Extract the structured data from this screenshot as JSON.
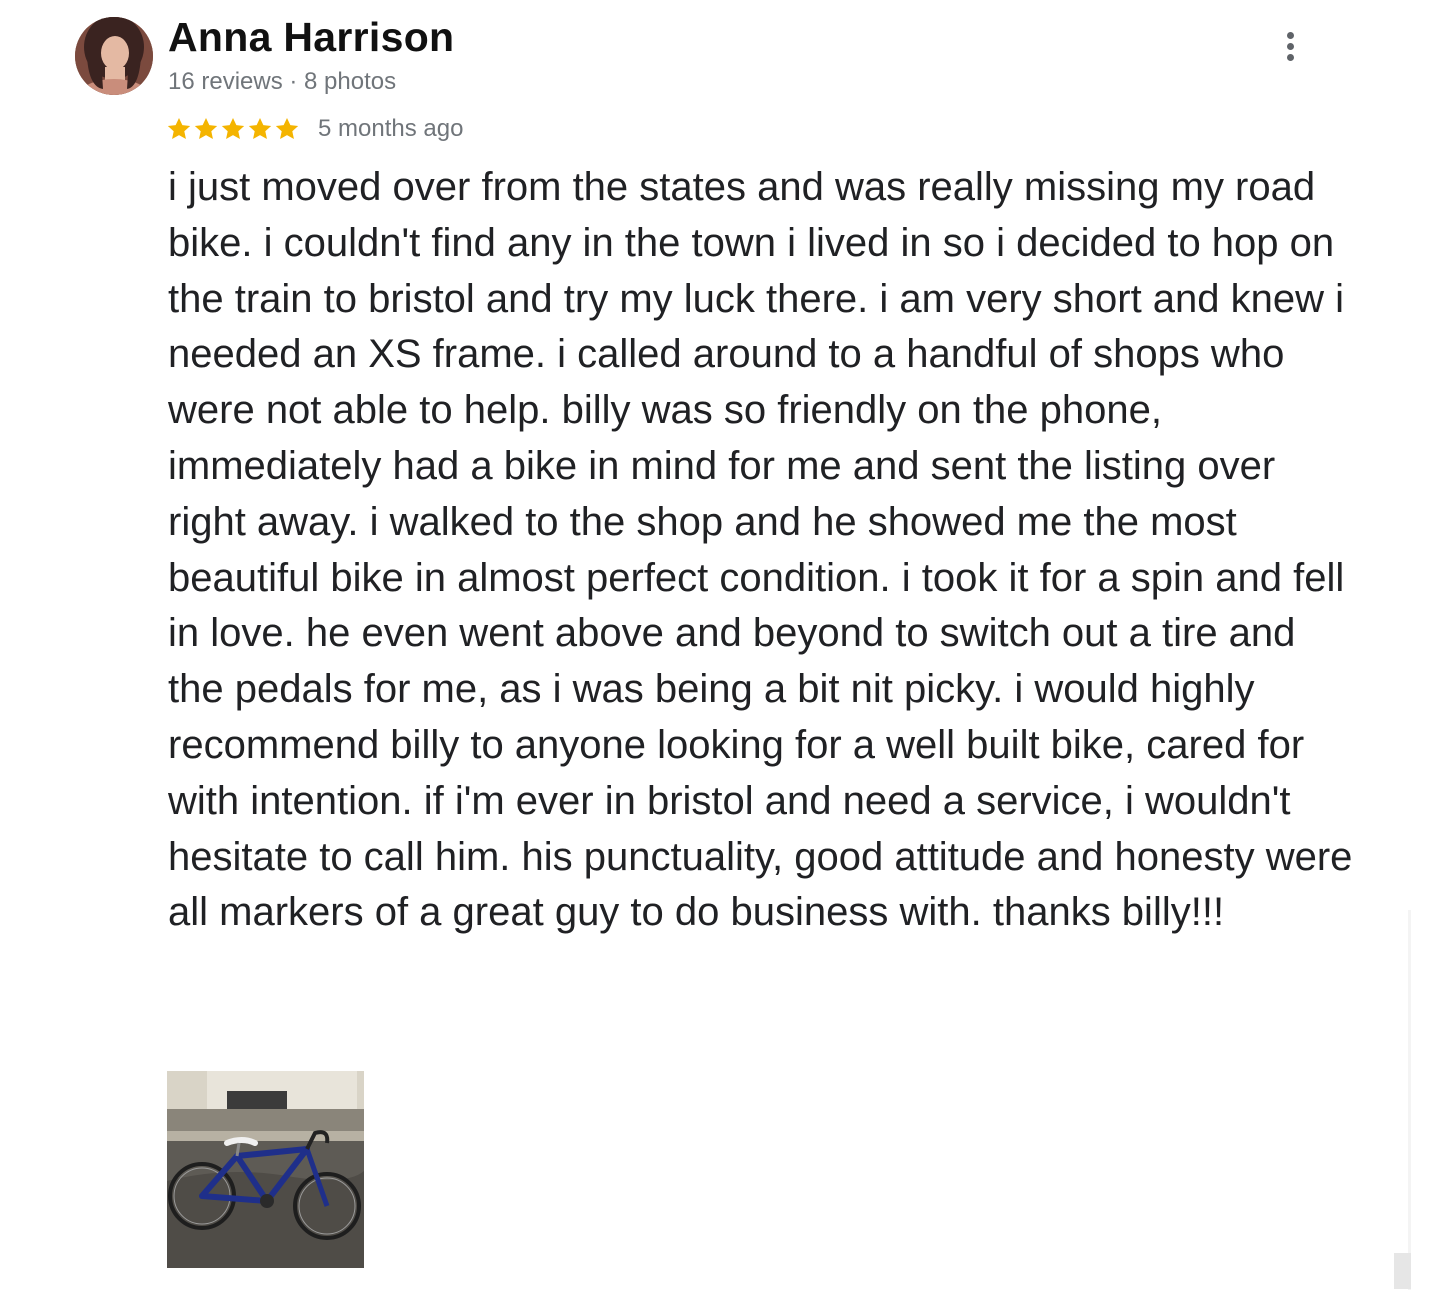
{
  "review": {
    "reviewer_name": "Anna Harrison",
    "reviewer_meta": "16 reviews · 8 photos",
    "rating": 5,
    "rating_max": 5,
    "time_ago": "5 months ago",
    "text": "i just moved over from the states and was really missing my road bike. i couldn't find any in the town i lived in so i decided to hop on the train to bristol and try my luck there. i am very short and knew i needed an XS frame. i called around to a handful of shops who were not able to help. billy was so friendly on the phone, immediately had a bike in mind for me and sent the listing over right away. i walked to the shop and he showed me the most beautiful bike in almost perfect condition. i took it for a spin and fell in love. he even went above and beyond to switch out a tire and the pedals for me, as i was being a bit nit picky. i would highly recommend billy to anyone looking for a well built bike, cared for with intention. if i'm ever in bristol and need a service, i wouldn't hesitate to call him. his punctuality, good attitude and honesty were all markers of a great guy to do business with. thanks billy!!!",
    "photos": [
      {
        "icon": "bike-photo"
      }
    ]
  },
  "icons": {
    "menu": "more-vert-icon",
    "star": "star-icon"
  },
  "colors": {
    "star": "#f4b400",
    "name": "#111111",
    "meta": "#70757a",
    "text": "#202124"
  }
}
